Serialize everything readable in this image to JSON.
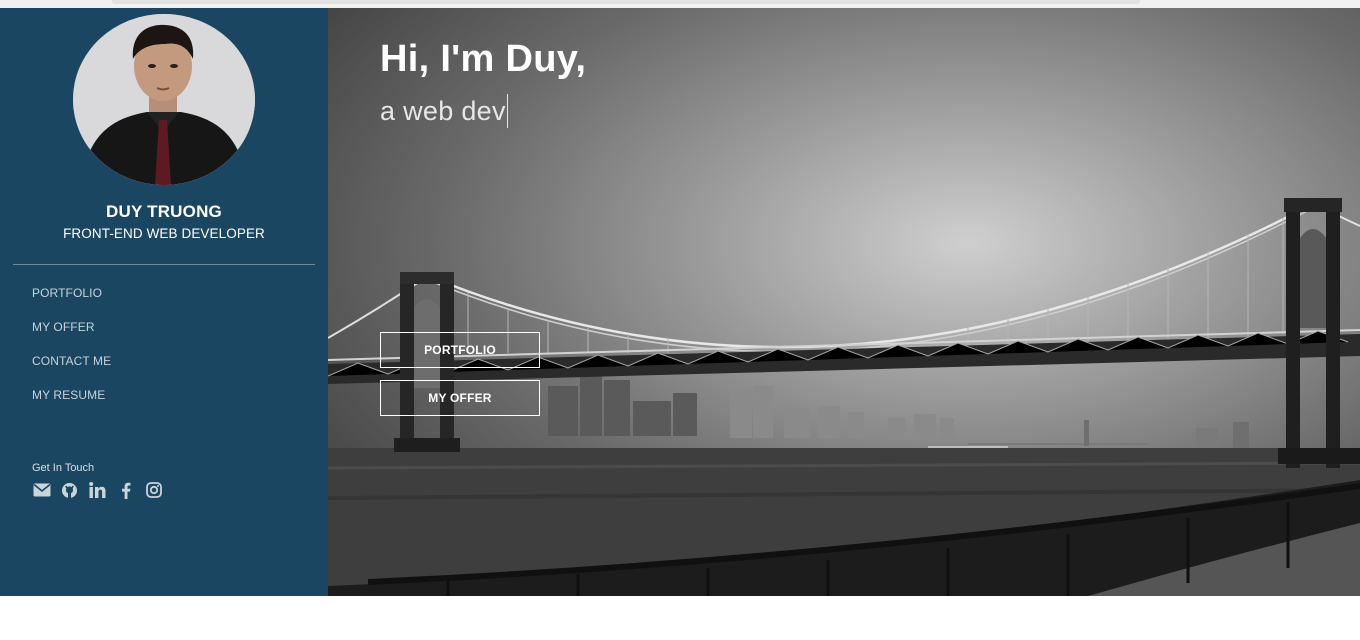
{
  "profile": {
    "name": "DUY TRUONG",
    "title": "FRONT-END WEB DEVELOPER",
    "avatar_description": "profile photo"
  },
  "nav": {
    "items": [
      "PORTFOLIO",
      "MY OFFER",
      "CONTACT ME",
      "MY RESUME"
    ]
  },
  "get_in_touch": {
    "label": "Get In Touch",
    "icons": [
      "envelope-icon",
      "github-icon",
      "linkedin-icon",
      "facebook-icon",
      "instagram-icon"
    ]
  },
  "hero": {
    "greeting": "Hi, I'm Duy,",
    "typed_text": "a web dev",
    "buttons": [
      "PORTFOLIO",
      "MY OFFER"
    ],
    "background_description": "black-and-white photo of a suspension bridge over a river with a city skyline"
  },
  "colors": {
    "sidebar_bg": "#1b4661",
    "text_white": "#ffffff",
    "nav_text": "#c7d2da"
  }
}
